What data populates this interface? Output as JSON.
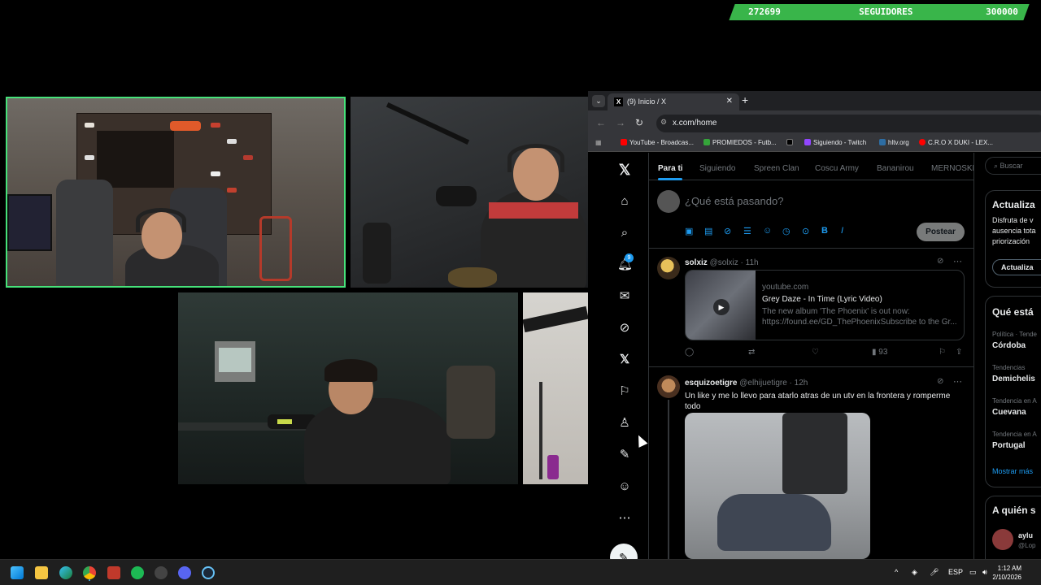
{
  "overlay": {
    "followers_current": "272699",
    "followers_label": "SEGUIDORES",
    "followers_goal": "300000",
    "followers_progress": 0.909
  },
  "browser": {
    "tab_title": "(9) Inicio / X",
    "url": "x.com/home",
    "bookmarks": [
      "YouTube - Broadcas...",
      "PROMIEDOS - Futb...",
      "",
      "Siguiendo - Twitch",
      "hltv.org",
      "C.R.O X DUKI - LEX..."
    ]
  },
  "x": {
    "feed_tabs": [
      "Para ti",
      "Siguiendo",
      "Spreen Clan",
      "Coscu Army",
      "Bananirou",
      "MERNOSKE"
    ],
    "notification_count": "9",
    "compose_placeholder": "¿Qué está pasando?",
    "post_button": "Postear",
    "tweets": [
      {
        "name": "solxiz",
        "handle": "@solxiz · 11h",
        "card": {
          "domain": "youtube.com",
          "title": "Grey Daze - In Time (Lyric Video)",
          "description": "The new album 'The Phoenix' is out now: https://found.ee/GD_ThePhoenixSubscribe to the Gr..."
        },
        "views": "93"
      },
      {
        "name": "esquizoetigre",
        "handle": "@elhijuetigre · 12h",
        "text": "Un like y me lo llevo para atarlo atras de un utv en la frontera y romperme todo"
      }
    ],
    "search_placeholder": "Buscar",
    "right": {
      "premium_title": "Actualiza",
      "premium_text": "Disfruta de v ausencia tota priorización",
      "premium_button": "Actualiza",
      "trends_title": "Qué está",
      "trends": [
        {
          "context": "Política · Tende",
          "name": "Córdoba"
        },
        {
          "context": "Tendencias",
          "name": "Demichelis"
        },
        {
          "context": "Tendencia en A",
          "name": "Cuevana"
        },
        {
          "context": "Tendencia en A",
          "name": "Portugal"
        }
      ],
      "show_more": "Mostrar más",
      "who_title": "A quién s",
      "who_name": "aylu",
      "who_handle": "@Lop"
    }
  },
  "taskbar": {
    "lang": "ESP",
    "time": "1:12 AM",
    "date": "2/10/2026"
  }
}
